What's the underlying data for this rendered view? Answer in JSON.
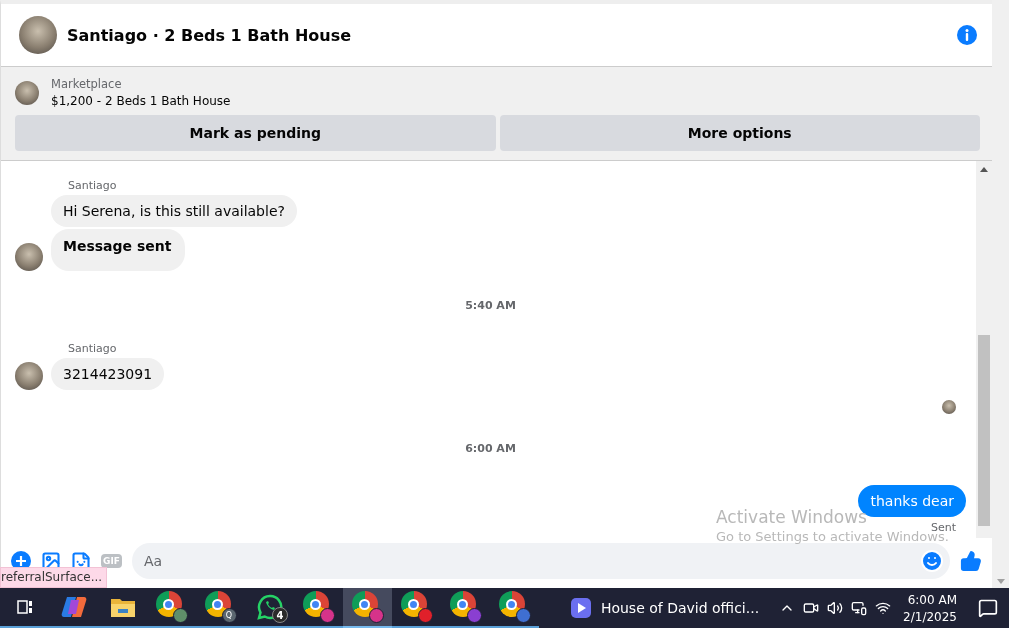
{
  "header": {
    "title": "Santiago · 2 Beds 1 Bath House"
  },
  "listing": {
    "source": "Marketplace",
    "title": "$1,200 - 2 Beds 1 Bath House",
    "buttons": [
      "Mark as pending",
      "More options"
    ]
  },
  "thread": [
    {
      "kind": "group",
      "sender": "Santiago",
      "bubbles": [
        {
          "text": "Hi Serena, is this still available?",
          "bold": false
        },
        {
          "text": "Message sent",
          "bold": true
        }
      ]
    },
    {
      "kind": "time",
      "text": "5:40 AM"
    },
    {
      "kind": "group",
      "sender": "Santiago",
      "bubbles": [
        {
          "text": "3214423091",
          "bold": false
        }
      ]
    },
    {
      "kind": "seen"
    },
    {
      "kind": "time",
      "text": "6:00 AM"
    },
    {
      "kind": "outgoing",
      "text": "thanks dear",
      "status": "Sent"
    }
  ],
  "composer": {
    "gif_label": "GIF",
    "placeholder": "Aa"
  },
  "status_link": "referralSurface...",
  "activation": {
    "title": "Activate Windows",
    "subtitle": "Go to Settings to activate Windows."
  },
  "taskbar": {
    "apps": [
      {
        "kind": "taskview",
        "selected": false
      },
      {
        "kind": "copilot",
        "selected": false
      },
      {
        "kind": "folder",
        "selected": false
      },
      {
        "kind": "browser",
        "selected": false,
        "color": "#5f8f6a"
      },
      {
        "kind": "browser",
        "selected": false,
        "color": "#5b6770",
        "badge": "Q"
      },
      {
        "kind": "whatsapp",
        "selected": false,
        "badge": "4"
      },
      {
        "kind": "browser",
        "selected": false,
        "color": "#d6338a"
      },
      {
        "kind": "browser",
        "selected": true,
        "color": "#d6338a"
      },
      {
        "kind": "browser",
        "selected": false,
        "color": "#e0202a"
      },
      {
        "kind": "browser",
        "selected": false,
        "color": "#8a3fd1"
      },
      {
        "kind": "browser",
        "selected": false,
        "color": "#3f6fd1"
      }
    ],
    "media": "House of David offici...",
    "time": "6:00 AM",
    "date": "2/1/2025"
  }
}
